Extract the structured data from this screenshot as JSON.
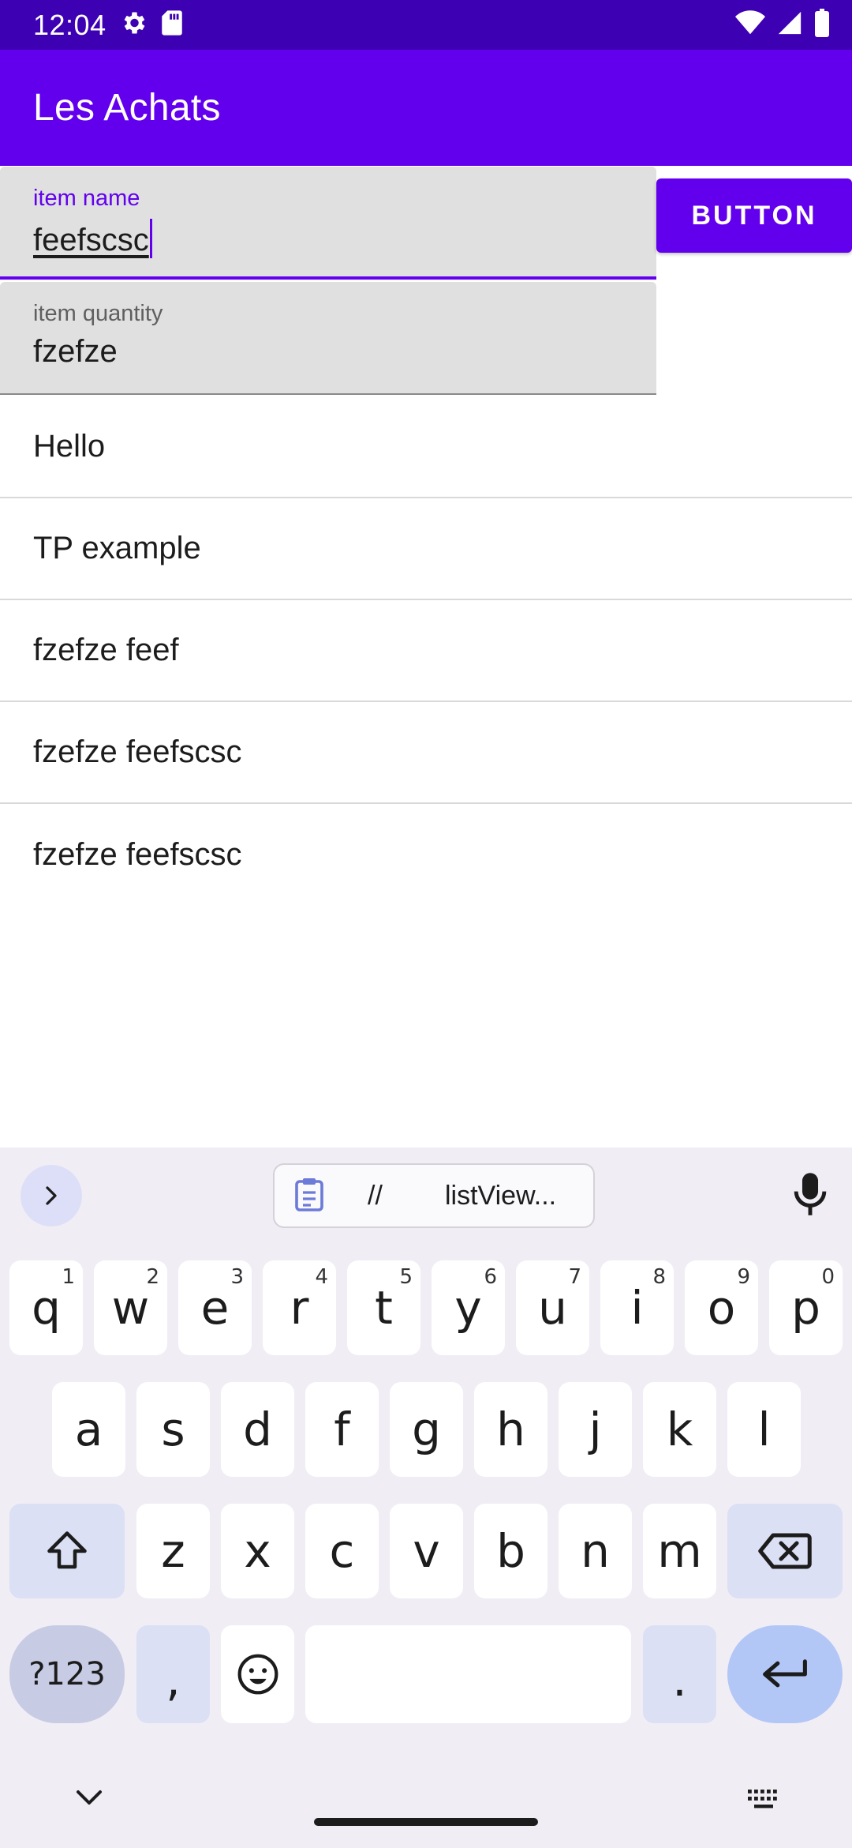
{
  "status_bar": {
    "time": "12:04",
    "left_icons": [
      "settings-icon",
      "sd-card-icon"
    ],
    "right_icons": [
      "wifi-icon",
      "signal-icon",
      "battery-icon"
    ]
  },
  "app_bar": {
    "title": "Les Achats"
  },
  "form": {
    "name_field": {
      "label": "item name",
      "value": "feefscsc"
    },
    "quantity_field": {
      "label": "item quantity",
      "value": "fzefze"
    },
    "button_label": "BUTTON"
  },
  "list": {
    "items": [
      "Hello",
      "TP example",
      "fzefze feef",
      "fzefze feefscsc",
      "fzefze feefscsc"
    ]
  },
  "keyboard": {
    "clipboard": {
      "part1": "//",
      "part2": "listView..."
    },
    "row1": [
      {
        "k": "q",
        "h": "1"
      },
      {
        "k": "w",
        "h": "2"
      },
      {
        "k": "e",
        "h": "3"
      },
      {
        "k": "r",
        "h": "4"
      },
      {
        "k": "t",
        "h": "5"
      },
      {
        "k": "y",
        "h": "6"
      },
      {
        "k": "u",
        "h": "7"
      },
      {
        "k": "i",
        "h": "8"
      },
      {
        "k": "o",
        "h": "9"
      },
      {
        "k": "p",
        "h": "0"
      }
    ],
    "row2": [
      "a",
      "s",
      "d",
      "f",
      "g",
      "h",
      "j",
      "k",
      "l"
    ],
    "row3": [
      "z",
      "x",
      "c",
      "v",
      "b",
      "n",
      "m"
    ],
    "symbols_key": "?123",
    "comma_key": ",",
    "period_key": "."
  },
  "colors": {
    "status_bar": "#3e00b3",
    "primary": "#6200ee",
    "field_bg": "#e0e0e0",
    "keyboard_bg": "#f0edf5"
  }
}
